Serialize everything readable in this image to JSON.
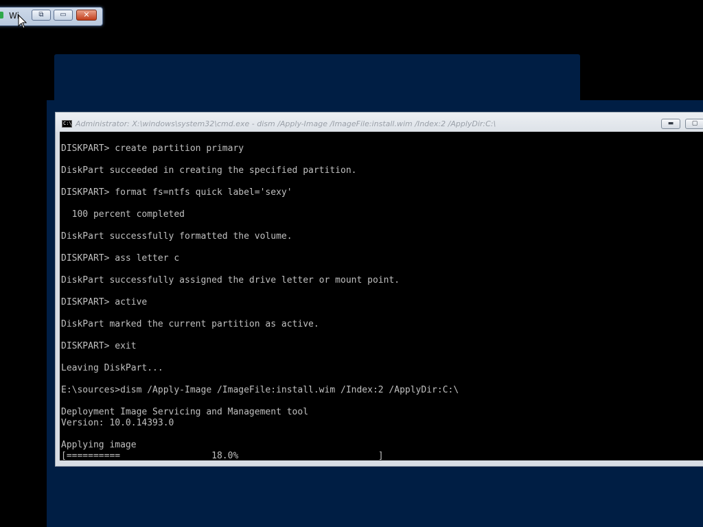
{
  "minimized_window": {
    "title": "Wi",
    "icons": [
      "restore-icon",
      "maximize-icon",
      "close-icon"
    ]
  },
  "cmd_window": {
    "title": "Administrator: X:\\windows\\system32\\cmd.exe - dism  /Apply-Image /ImageFile:install.wim /Index:2 /ApplyDir:C:\\",
    "icon_label": "C:\\",
    "buttons": [
      "minimize-icon",
      "maximize-icon"
    ],
    "text_color": "#c0c0c0",
    "background_color": "#000000"
  },
  "console": {
    "lines": [
      "DISKPART> create partition primary",
      "",
      "DiskPart succeeded in creating the specified partition.",
      "",
      "DISKPART> format fs=ntfs quick label='sexy'",
      "",
      "  100 percent completed",
      "",
      "DiskPart successfully formatted the volume.",
      "",
      "DISKPART> ass letter c",
      "",
      "DiskPart successfully assigned the drive letter or mount point.",
      "",
      "DISKPART> active",
      "",
      "DiskPart marked the current partition as active.",
      "",
      "DISKPART> exit",
      "",
      "Leaving DiskPart...",
      "",
      "E:\\sources>dism /Apply-Image /ImageFile:install.wim /Index:2 /ApplyDir:C:\\",
      "",
      "Deployment Image Servicing and Management tool",
      "Version: 10.0.14393.0",
      "",
      "Applying image",
      "[==========                 18.0%                          ]"
    ]
  },
  "progress": {
    "percent": 18.0
  }
}
